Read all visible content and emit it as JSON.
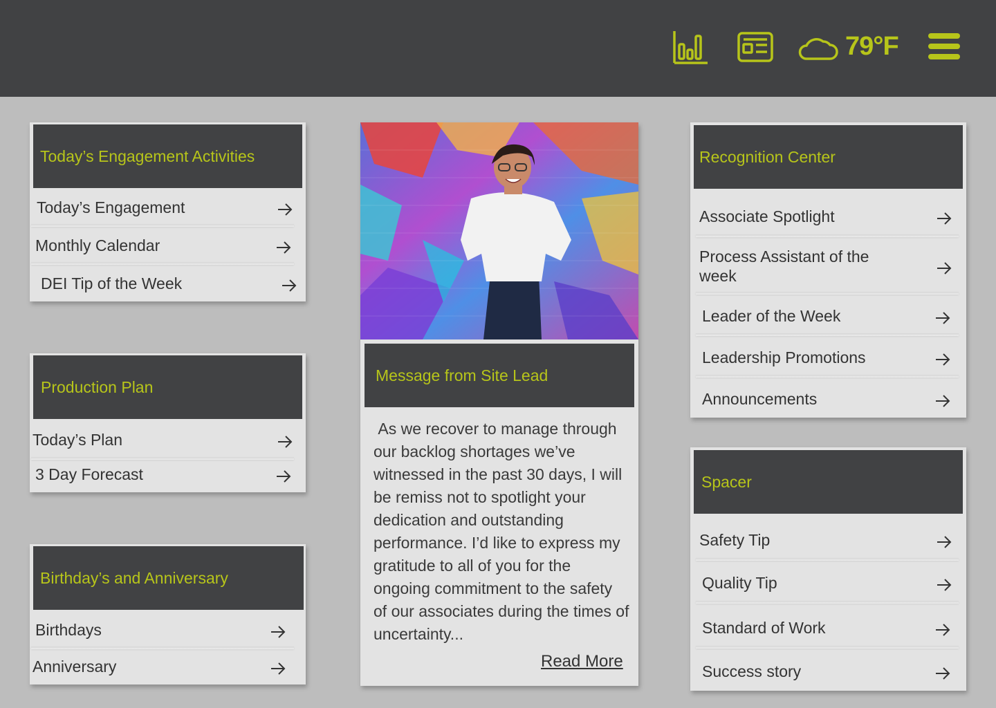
{
  "header": {
    "temperature": "79°F",
    "icons": [
      "bar-chart-icon",
      "newspaper-icon",
      "cloud-icon",
      "menu-icon"
    ],
    "accent_color": "#b7c51a",
    "bar_color": "#414244"
  },
  "engagement": {
    "title": "Today’s Engagement Activities",
    "items": [
      "Today’s Engagement",
      "Monthly Calendar",
      "DEI Tip of the Week"
    ]
  },
  "production": {
    "title": "Production Plan",
    "items": [
      "Today’s Plan",
      "3 Day Forecast"
    ]
  },
  "birthdays": {
    "title": "Birthday’s and Anniversary",
    "items": [
      "Birthdays",
      "Anniversary"
    ]
  },
  "message": {
    "title": "Message from Site Lead",
    "body": " As we recover to manage through our backlog shortages we’ve witnessed in the past 30 days, I will be remiss not to spotlight your dedication and outstanding performance. I’d like to express my gratitude to all of you for the ongoing commitment to the safety of our associates during the times of uncertainty...",
    "read_more": "Read More"
  },
  "recognition": {
    "title": "Recognition Center",
    "items": [
      "Associate Spotlight",
      "Process Assistant of the week",
      "Leader of the Week",
      "Leadership Promotions",
      "Announcements"
    ]
  },
  "spacer": {
    "title": "Spacer",
    "items": [
      "Safety Tip",
      "Quality Tip",
      "Standard of Work",
      "Success story"
    ]
  }
}
